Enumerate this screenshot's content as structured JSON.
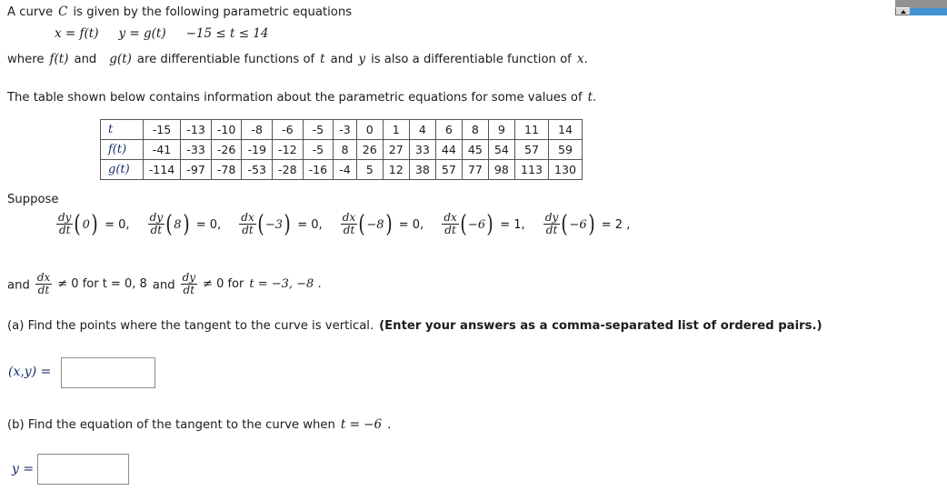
{
  "problem": {
    "line1": {
      "a": "A curve",
      "var_c": "C",
      "b": "is given by the following parametric equations"
    },
    "line2": {
      "x_eq": "x = f(t)",
      "y_eq": "y = g(t)",
      "domain": "−15 ≤ t ≤ 14"
    },
    "line3": {
      "a": "where",
      "ft": "f(t)",
      "b": "and",
      "gt": "g(t)",
      "c": "are differentiable functions of",
      "t": "t",
      "d": "and",
      "y": "y",
      "e": "is also a differentiable function of",
      "x": "x",
      "f": "."
    },
    "table_intro": "The table shown below contains information about the parametric equations for some values of",
    "table_intro_var": "t",
    "table_intro_end": ".",
    "suppose_label": "Suppose",
    "and_line": {
      "and": "and",
      "frac1_num": "dx",
      "frac1_den": "dt",
      "mid1": "≠ 0 for t = 0, 8",
      "and2": "and",
      "frac2_num": "dy",
      "frac2_den": "dt",
      "mid2": "≠ 0  for",
      "t_values": "t = −3, −8 ."
    }
  },
  "table": {
    "row_labels": [
      "t",
      "f(t)",
      "g(t)"
    ],
    "t": [
      "-15",
      "-13",
      "-10",
      "-8",
      "-6",
      "-5",
      "-3",
      "0",
      "1",
      "4",
      "6",
      "8",
      "9",
      "11",
      "14"
    ],
    "f_t": [
      "-41",
      "-33",
      "-26",
      "-19",
      "-12",
      "-5",
      "8",
      "26",
      "27",
      "33",
      "44",
      "45",
      "54",
      "57",
      "59"
    ],
    "g_t": [
      "-114",
      "-97",
      "-78",
      "-53",
      "-28",
      "-16",
      "-4",
      "5",
      "12",
      "38",
      "57",
      "77",
      "98",
      "113",
      "130"
    ]
  },
  "derivatives": [
    {
      "num": "dy",
      "den": "dt",
      "arg": "0",
      "value": "= 0,"
    },
    {
      "num": "dy",
      "den": "dt",
      "arg": "8",
      "value": "= 0,"
    },
    {
      "num": "dx",
      "den": "dt",
      "arg": "−3",
      "value": "= 0,"
    },
    {
      "num": "dx",
      "den": "dt",
      "arg": "−8",
      "value": "= 0,"
    },
    {
      "num": "dx",
      "den": "dt",
      "arg": "−6",
      "value": "= 1,"
    },
    {
      "num": "dy",
      "den": "dt",
      "arg": "−6",
      "value": "= 2 ,"
    }
  ],
  "questions": {
    "a": {
      "prompt": "(a) Find the points where the tangent to the curve is vertical.",
      "instruction": "(Enter your answers as a comma-separated list of ordered pairs.)",
      "answer_label": "(x,y) =",
      "answer_value": "",
      "answer_placeholder": ""
    },
    "b": {
      "prompt_a": "(b) Find the equation of the tangent to the curve when",
      "prompt_var": "t = −6",
      "prompt_end": ".",
      "answer_label": "y =",
      "answer_value": "",
      "answer_placeholder": ""
    }
  },
  "scrollbar": {
    "up_arrow": "▲",
    "track_color": "#919191",
    "thumb_color": "#4292d6"
  }
}
